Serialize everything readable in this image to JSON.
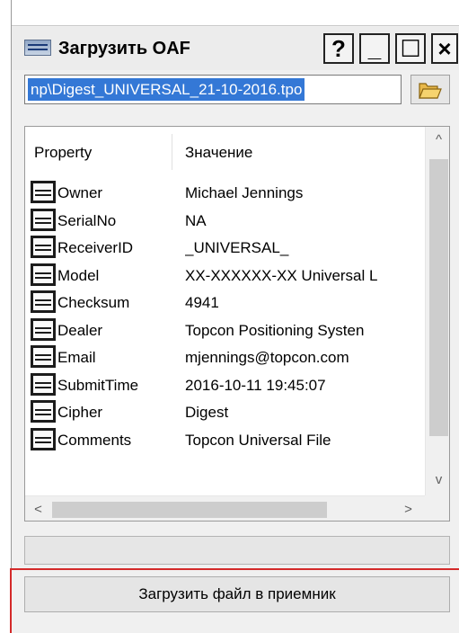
{
  "window": {
    "title": "Загрузить OAF",
    "help_label": "?",
    "minimize_label": "_",
    "maximize_label": "☐",
    "close_label": "×"
  },
  "path": {
    "value": "np\\Digest_UNIVERSAL_21-10-2016.tpo"
  },
  "grid": {
    "columns": [
      "Property",
      "Значение"
    ],
    "rows": [
      {
        "property": "Owner",
        "value": "Michael Jennings"
      },
      {
        "property": "SerialNo",
        "value": "NA"
      },
      {
        "property": "ReceiverID",
        "value": "_UNIVERSAL_"
      },
      {
        "property": "Model",
        "value": "XX-XXXXXX-XX Universal L"
      },
      {
        "property": "Checksum",
        "value": "4941"
      },
      {
        "property": "Dealer",
        "value": "Topcon Positioning Systen"
      },
      {
        "property": "Email",
        "value": "mjennings@topcon.com"
      },
      {
        "property": "SubmitTime",
        "value": "2016-10-11 19:45:07"
      },
      {
        "property": "Cipher",
        "value": "Digest"
      },
      {
        "property": "Comments",
        "value": "Topcon Universal File"
      }
    ]
  },
  "scroll": {
    "up_arrow": "^",
    "down_arrow": "v",
    "left_arrow": "<",
    "right_arrow": ">"
  },
  "actions": {
    "load_button_label": "Загрузить файл в приемник"
  },
  "colors": {
    "selection": "#3478d6",
    "highlight_frame": "#d42a2a"
  },
  "icons": {
    "app": "app-window-icon",
    "folder": "folder-open-icon",
    "row": "property-row-icon"
  }
}
